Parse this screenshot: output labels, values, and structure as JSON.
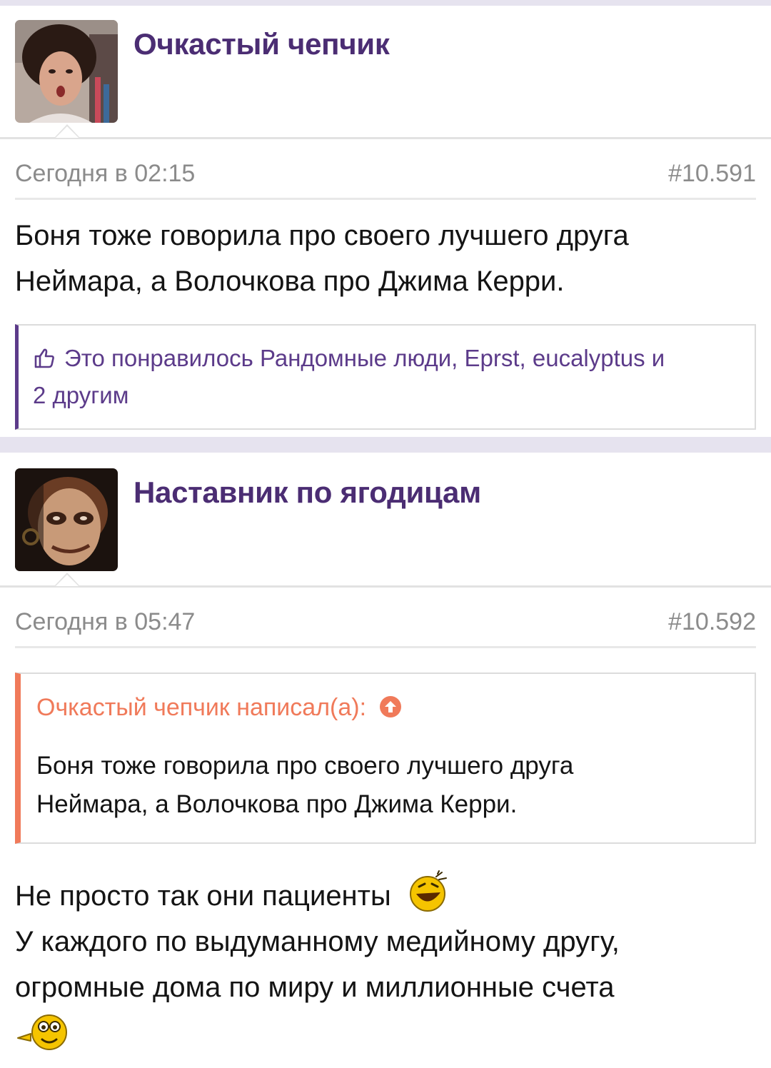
{
  "posts": [
    {
      "username": "Очкастый чепчик",
      "date": "Сегодня в 02:15",
      "number": "#10.591",
      "message_lines": [
        "Боня тоже говорила про своего лучшего друга",
        "Неймара, а Волочкова про Джима Керри."
      ],
      "likes_line1": "Это понравилось Рандомные люди, Eprst, eucalyptus и",
      "likes_line2": "2 другим"
    },
    {
      "username": "Наставник по ягодицам",
      "date": "Сегодня в 05:47",
      "number": "#10.592",
      "quote": {
        "author": "Очкастый чепчик написал(а):",
        "lines": [
          "Боня тоже говорила про своего лучшего друга",
          "Неймара, а Волочкова про Джима Керри."
        ]
      },
      "message_lines": [
        "Не просто так они пациенты",
        "У каждого по выдуманному медийному другу,",
        "огромные дома по миру и миллионные счета"
      ]
    }
  ],
  "icons": {
    "like": "thumbs-up-icon",
    "quote_jump": "arrow-up-circle-icon",
    "smiley_1": "laughing-smiley-icon",
    "smiley_2": "pointing-smiley-icon"
  },
  "colors": {
    "username": "#4b2d73",
    "likes_accent": "#5c3b8a",
    "quote_accent": "#f07a5a",
    "meta_text": "#8b8b8b",
    "separator": "#e6e3ef"
  }
}
